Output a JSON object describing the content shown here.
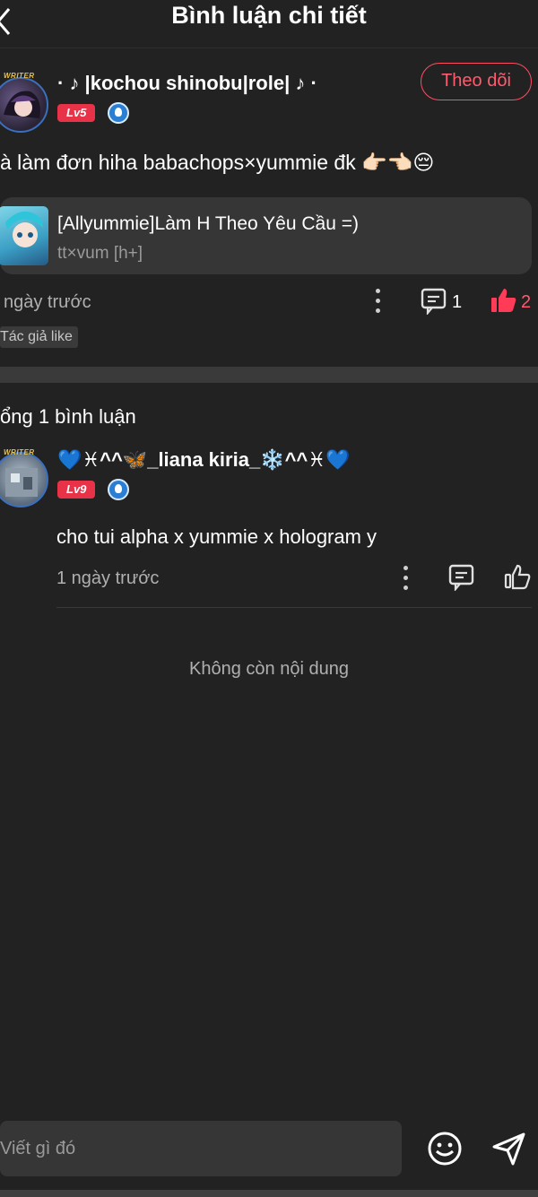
{
  "header": {
    "title": "Bình luận chi tiết",
    "back_icon": "chevron-left-icon"
  },
  "post": {
    "author": "· ♪ |kochou shinobu|role| ♪ ·",
    "level": "Lv5",
    "avatar_badge": "WRITER",
    "follow_label": "Theo dõi",
    "content": "à làm đơn hiha babachops×yummie đk",
    "content_emojis": "👉🏻👈🏻😔",
    "attachment": {
      "title": "[Allyummie]Làm H Theo Yêu Cầu =)",
      "subtitle": "tt×vum [h+]"
    },
    "time": "ngày trước",
    "comment_count": "1",
    "like_count": "2",
    "author_like": "Tác giả like"
  },
  "comments": {
    "total_label": "ổng 1 bình luận",
    "items": [
      {
        "author": "💙♓^^🦋_liana kiria_❄️^^♓💙",
        "level": "Lv9",
        "avatar_badge": "WRITER",
        "text": "cho tui alpha x yummie x hologram y",
        "time": "1 ngày trước"
      }
    ],
    "empty_label": "Không còn nội dung"
  },
  "composer": {
    "placeholder": "Viết gì đó"
  },
  "colors": {
    "background": "#222222",
    "accent": "#ff4d62",
    "level_badge": "#e83248",
    "card": "#363636"
  }
}
